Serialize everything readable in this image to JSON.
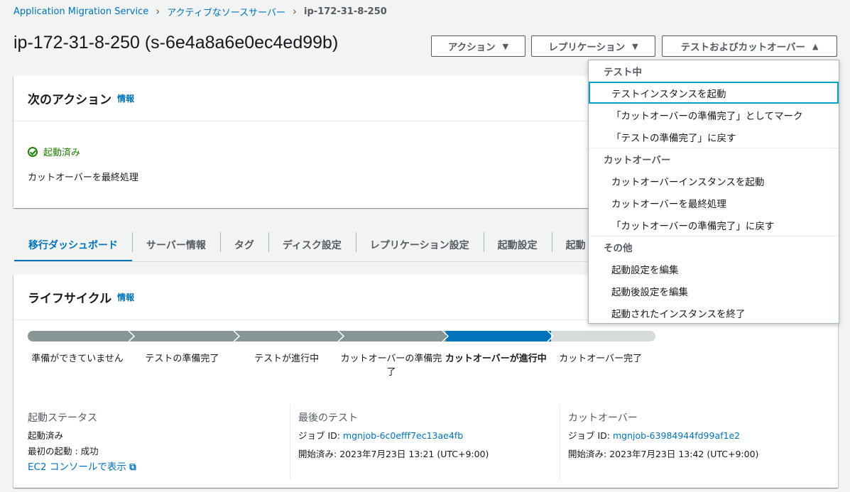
{
  "breadcrumb": {
    "items": [
      "Application Migration Service",
      "アクティブなソースサーバー"
    ],
    "current": "ip-172-31-8-250"
  },
  "page": {
    "title": "ip-172-31-8-250 (s-6e4a8a6e0ec4ed99b)"
  },
  "buttons": {
    "actions": "アクション",
    "replication": "レプリケーション",
    "test_cutover": "テストおよびカットオーバー"
  },
  "next_action": {
    "title": "次のアクション",
    "info": "情報",
    "status": "起動済み",
    "action_text": "カットオーバーを最終処理"
  },
  "tabs": [
    "移行ダッシュボード",
    "サーバー情報",
    "タグ",
    "ディスク設定",
    "レプリケーション設定",
    "起動設定",
    "起動"
  ],
  "lifecycle": {
    "title": "ライフサイクル",
    "info": "情報",
    "steps": [
      "準備ができていません",
      "テストの準備完了",
      "テストが進行中",
      "カットオーバーの準備完了",
      "カットオーバーが進行中",
      "カットオーバー完了"
    ],
    "current_step_index": 4,
    "launch_status": {
      "label": "起動ステータス",
      "value": "起動済み",
      "first_launch": "最初の起動 : 成功",
      "ec2_link": "EC2 コンソールで表示"
    },
    "last_test": {
      "label": "最後のテスト",
      "job_label": "ジョブ ID:",
      "job_id": "mgnjob-6c0efff7ec13ae4fb",
      "started_label": "開始済み:",
      "started": "2023年7月23日 13:21 (UTC+9:00)"
    },
    "cutover": {
      "label": "カットオーバー",
      "job_label": "ジョブ ID:",
      "job_id": "mgnjob-63984944fd99af1e2",
      "started_label": "開始済み:",
      "started": "2023年7月23日 13:42 (UTC+9:00)"
    }
  },
  "dropdown": {
    "groups": [
      {
        "label": "テスト中",
        "items": [
          "テストインスタンスを起動",
          "「カットオーバーの準備完了」としてマーク",
          "「テストの準備完了」に戻す"
        ]
      },
      {
        "label": "カットオーバー",
        "items": [
          "カットオーバーインスタンスを起動",
          "カットオーバーを最終処理",
          "「カットオーバーの準備完了」に戻す"
        ]
      },
      {
        "label": "その他",
        "items": [
          "起動設定を編集",
          "起動後設定を編集",
          "起動されたインスタンスを終了"
        ]
      }
    ]
  },
  "colors": {
    "accent": "#0073bb",
    "success": "#1d8102",
    "progress_done": "#879596",
    "progress_todo": "#d5dbdb"
  }
}
